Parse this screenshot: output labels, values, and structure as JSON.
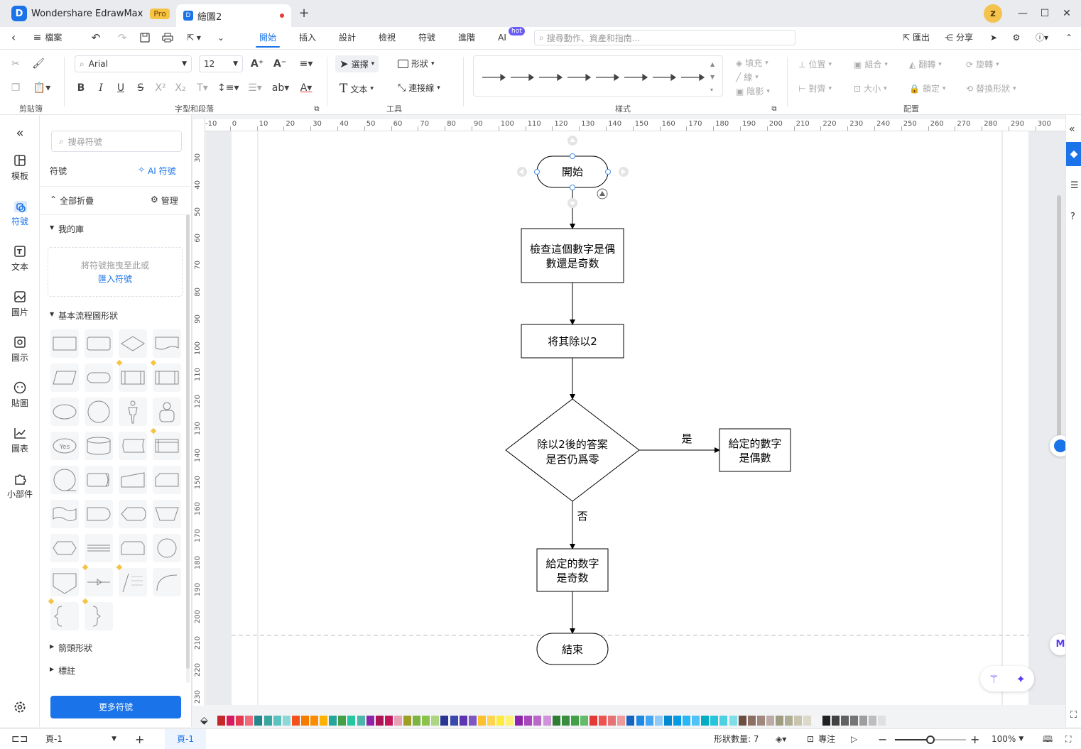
{
  "app": {
    "name": "Wondershare EdrawMax",
    "badge": "Pro",
    "avatar_letter": "z"
  },
  "doc_tab": {
    "title": "繪圖2",
    "new_tab_label": "+"
  },
  "window_controls": {
    "minimize": "—",
    "maximize": "☐",
    "close": "✕"
  },
  "menubar": {
    "file": "檔案",
    "tabs": [
      "開始",
      "插入",
      "設計",
      "檢視",
      "符號",
      "進階",
      "AI"
    ],
    "active_tab": "開始",
    "ai_badge": "hot",
    "search_placeholder": "搜尋動作、資產和指南...",
    "export": "匯出",
    "share": "分享"
  },
  "ribbon": {
    "clipboard_label": "剪貼簿",
    "font_family": "Arial",
    "font_size": "12",
    "font_group_label": "字型和段落",
    "select": "選擇",
    "shape": "形狀",
    "text": "文本",
    "connector": "連接線",
    "tools_label": "工具",
    "style_label": "樣式",
    "fill": "填充",
    "line": "線",
    "shadow": "陰影",
    "position": "位置",
    "group": "組合",
    "flip": "翻轉",
    "rotate": "旋轉",
    "align": "對齊",
    "size": "大小",
    "lock": "鎖定",
    "replace_shape": "替換形狀",
    "arrange_label": "配置"
  },
  "leftnav": {
    "items": [
      {
        "label": "模板",
        "icon": "template-icon"
      },
      {
        "label": "符號",
        "icon": "symbol-icon"
      },
      {
        "label": "文本",
        "icon": "text-icon"
      },
      {
        "label": "圖片",
        "icon": "image-icon"
      },
      {
        "label": "圖示",
        "icon": "icon-library-icon"
      },
      {
        "label": "貼圖",
        "icon": "sticker-icon"
      },
      {
        "label": "圖表",
        "icon": "chart-icon"
      },
      {
        "label": "小部件",
        "icon": "widget-icon"
      }
    ],
    "active": "符號"
  },
  "symbol_panel": {
    "search_placeholder": "搜尋符號",
    "title": "符號",
    "ai_symbol": "AI 符號",
    "collapse_all": "全部折疊",
    "manage": "管理",
    "my_library": "我的庫",
    "drop_hint": "將符號拖曳至此或",
    "import_link": "匯入符號",
    "basic_flowchart": "基本流程圖形狀",
    "arrow_shapes": "箭頭形狀",
    "annotations": "標註",
    "more_symbols": "更多符號",
    "yes_shape_text": "Yes"
  },
  "ruler": {
    "top": [
      "-10",
      "0",
      "10",
      "20",
      "30",
      "40",
      "50",
      "60",
      "70",
      "80",
      "90",
      "100",
      "110",
      "120",
      "130",
      "140",
      "150",
      "160",
      "170",
      "180",
      "190",
      "200",
      "210",
      "220",
      "230",
      "240",
      "250",
      "260",
      "270",
      "280",
      "290",
      "300"
    ],
    "left": [
      "30",
      "40",
      "50",
      "60",
      "70",
      "80",
      "90",
      "100",
      "110",
      "120",
      "130",
      "140",
      "150",
      "160",
      "170",
      "180",
      "190",
      "200",
      "210",
      "220",
      "230"
    ]
  },
  "flowchart": {
    "start": "開始",
    "check_line1": "檢查這個數字是偶",
    "check_line2": "數還是奇数",
    "divide": "将其除以2",
    "decision_line1": "除以2後的答案",
    "decision_line2": "是否仍爲零",
    "yes_label": "是",
    "no_label": "否",
    "even_line1": "給定的數字",
    "even_line2": "是偶數",
    "odd_line1": "給定的数字",
    "odd_line2": "是奇数",
    "end": "結束"
  },
  "palette": [
    "#c62828",
    "#d81b60",
    "#e53950",
    "#ef6b7d",
    "#26868e",
    "#3aa6a0",
    "#5cc2c0",
    "#8cd8d6",
    "#f4511e",
    "#f57c00",
    "#fb8c00",
    "#ffb300",
    "#26a69a",
    "#43a047",
    "#26c6a0",
    "#4db6ac",
    "#8e24aa",
    "#ad1457",
    "#c2185b",
    "#e8a0b4",
    "#9e9d24",
    "#7cb342",
    "#8bc34a",
    "#aed581",
    "#283593",
    "#3949ab",
    "#5e35b1",
    "#7e57c2",
    "#fbc02d",
    "#ffd54f",
    "#ffeb3b",
    "#fff176",
    "#8e24aa",
    "#ab47bc",
    "#ba68c8",
    "#ce93d8",
    "#2e7d32",
    "#388e3c",
    "#43a047",
    "#66bb6a",
    "#e53935",
    "#ef5350",
    "#e57373",
    "#ef9a9a",
    "#1565c0",
    "#1e88e5",
    "#42a5f5",
    "#90caf9",
    "#0288d1",
    "#039be5",
    "#29b6f6",
    "#4fc3f7",
    "#00acc1",
    "#26c6da",
    "#4dd0e1",
    "#80deea",
    "#6d4c41",
    "#8d6e63",
    "#a1887f",
    "#bcaaa4",
    "#9e9d80",
    "#b0ad95",
    "#c8c4ae",
    "#dcd9c8",
    "#f5f5f5",
    "#212121",
    "#424242",
    "#616161",
    "#757575",
    "#9e9e9e",
    "#bdbdbd",
    "#e0e0e0"
  ],
  "status": {
    "page_selector": "頁-1",
    "active_page": "頁-1",
    "shape_count": "形狀數量: 7",
    "focus": "專注",
    "zoom": "100%",
    "zoom_fraction": 0.5
  }
}
